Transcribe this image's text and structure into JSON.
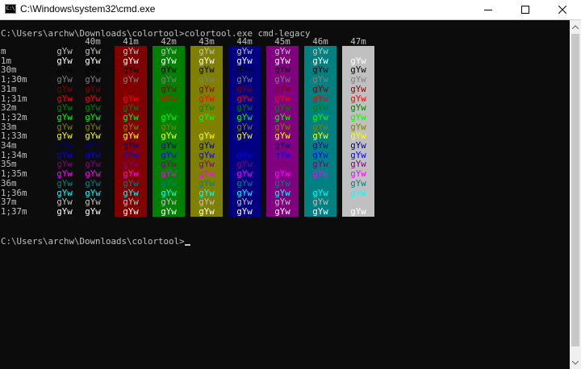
{
  "window": {
    "title": "C:\\Windows\\system32\\cmd.exe",
    "app_icon_label": "C:\\"
  },
  "console": {
    "command_line": "C:\\Users\\archw\\Downloads\\colortool>colortool.exe cmd-legacy",
    "prompt_line": "C:\\Users\\archw\\Downloads\\colortool>",
    "sample_text": "gYw",
    "headers": [
      "40m",
      "41m",
      "42m",
      "43m",
      "44m",
      "45m",
      "46m",
      "47m"
    ],
    "row_labels": [
      "m",
      "1m",
      "30m",
      "1;30m",
      "31m",
      "1;31m",
      "32m",
      "1;32m",
      "33m",
      "1;33m",
      "34m",
      "1;34m",
      "35m",
      "1;35m",
      "36m",
      "1;36m",
      "37m",
      "1;37m"
    ],
    "row_fg_colors": [
      "#c0c0c0",
      "#ffffff",
      "#000000",
      "#808080",
      "#800000",
      "#ff0000",
      "#008000",
      "#00ff00",
      "#808000",
      "#ffff00",
      "#000080",
      "#0000ff",
      "#800080",
      "#ff00ff",
      "#008080",
      "#00ffff",
      "#c0c0c0",
      "#ffffff"
    ],
    "default_fg": "#c0c0c0",
    "bg_colors": [
      "#000000",
      "#800000",
      "#008000",
      "#808000",
      "#000080",
      "#800080",
      "#008080",
      "#c0c0c0"
    ]
  }
}
